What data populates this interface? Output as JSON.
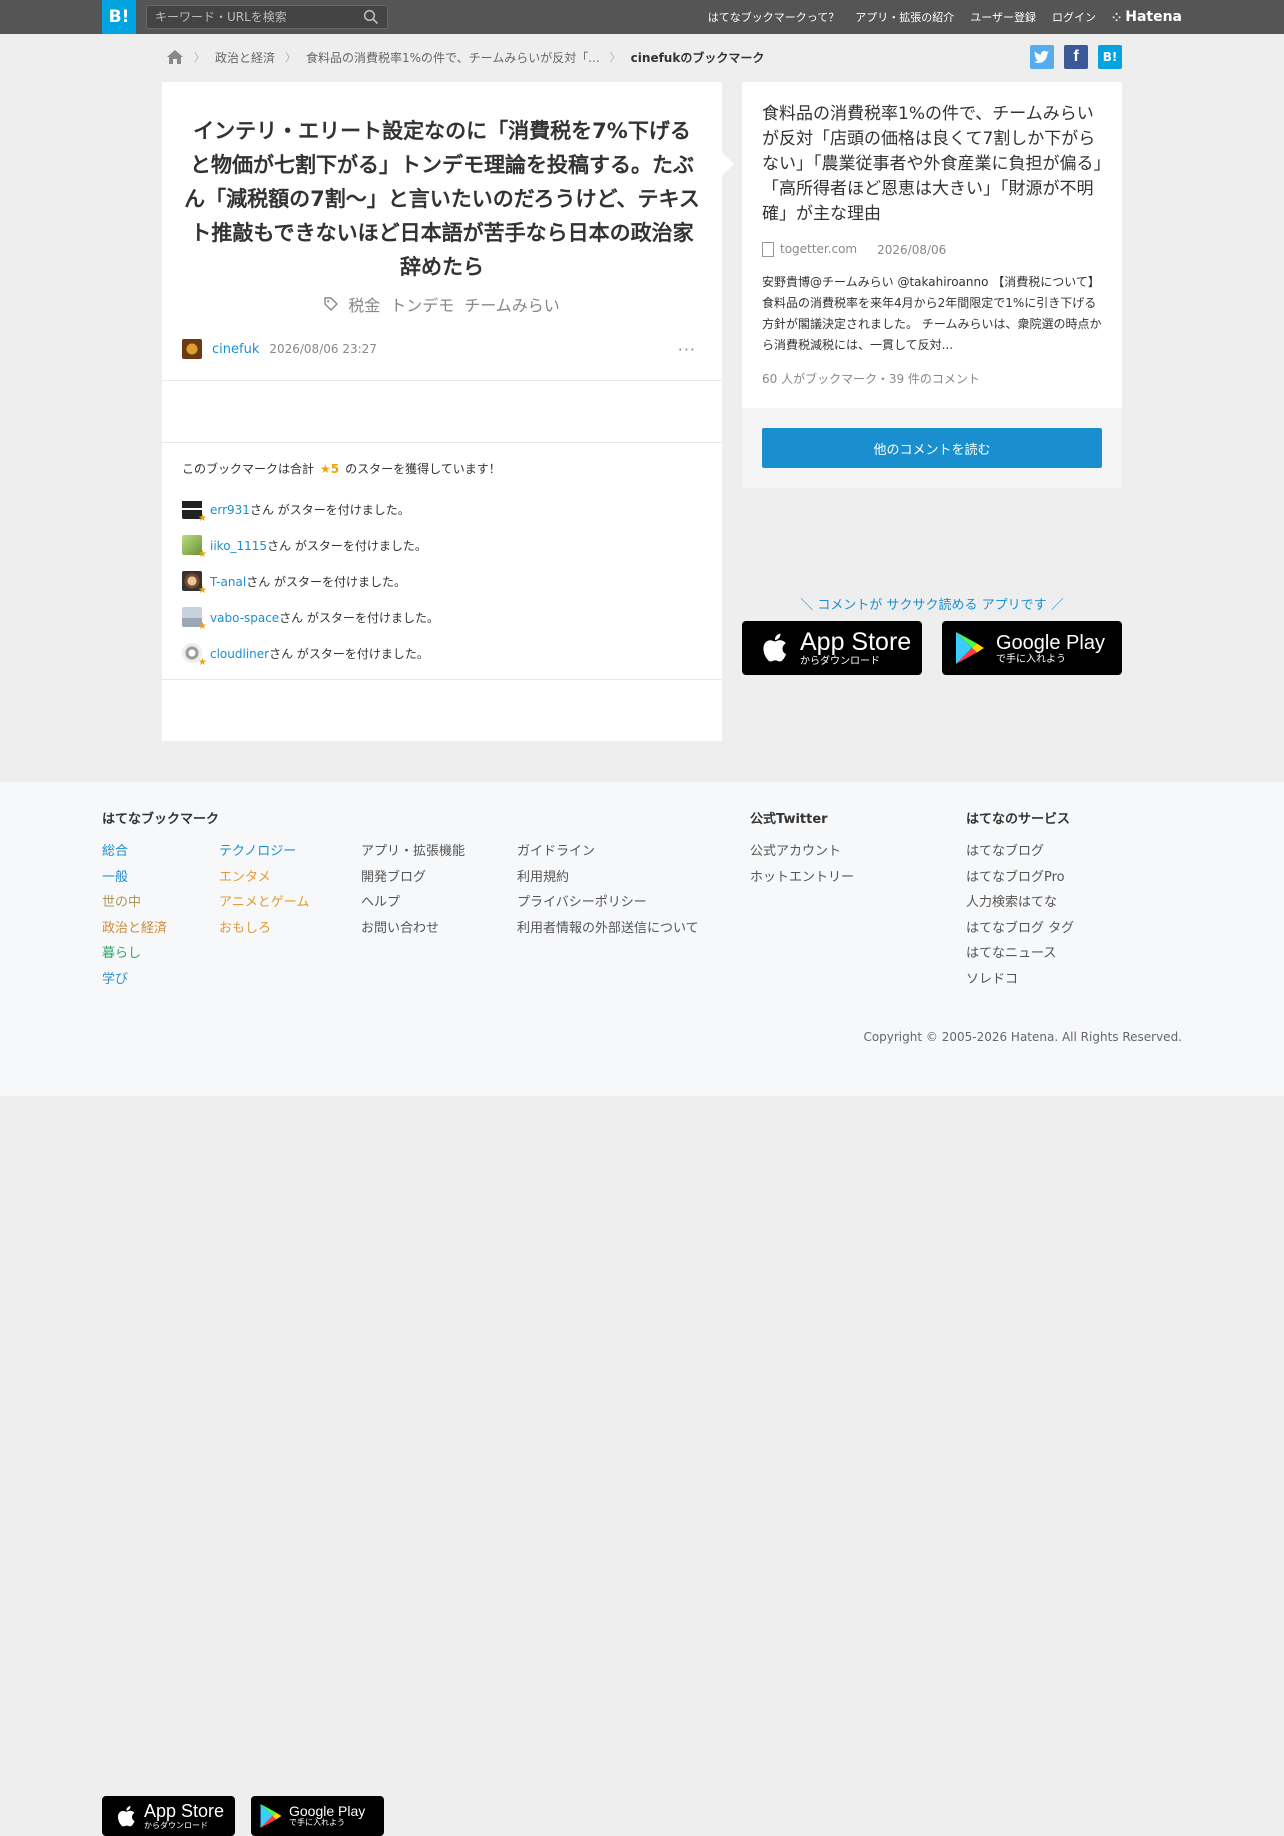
{
  "header": {
    "logo": "B!",
    "search_placeholder": "キーワード・URLを検索",
    "nav": [
      "はてなブックマークって？",
      "アプリ・拡張の紹介",
      "ユーザー登録",
      "ログイン"
    ],
    "hatena": "Hatena"
  },
  "breadcrumb": {
    "items": [
      "政治と経済",
      "食料品の消費税率1%の件で、チームみらいが反対「...",
      "cinefukのブックマーク"
    ]
  },
  "share": {
    "twitter": "t",
    "facebook": "f",
    "hatena": "B!"
  },
  "bookmark": {
    "comment": "インテリ・エリート設定なのに「消費税を7%下げると物価が七割下がる」トンデモ理論を投稿する。たぶん「減税額の7割〜」と言いたいのだろうけど、テキスト推敲もできないほど日本語が苦手なら日本の政治家辞めたら",
    "tags": [
      "税金",
      "トンデモ",
      "チームみらい"
    ],
    "author": "cinefuk",
    "date": "2026/08/06 23:27",
    "more": "···"
  },
  "stars": {
    "summary_prefix": "このブックマークは合計",
    "count": "★5",
    "summary_suffix": "のスターを獲得しています！",
    "suffix_text": "さん がスターを付けました。",
    "users": [
      "err931",
      "iiko_1115",
      "T-anal",
      "vabo-space",
      "cloudliner"
    ]
  },
  "entry": {
    "title": "食料品の消費税率1%の件で、チームみらいが反対「店頭の価格は良くて7割しか下がらない」「農業従事者や外食産業に負担が偏る」「高所得者ほど恩恵は大きい」「財源が不明確」が主な理由",
    "domain": "togetter.com",
    "date": "2026/08/06",
    "summary": "安野貴博@チームみらい @takahiroanno 【消費税について】 食料品の消費税率を来年4月から2年間限定で1%に引き下げる方針が閣議決定されました。 チームみらいは、衆院選の時点から消費税減税には、一貫して反対...",
    "stats": "60 人がブックマーク・39 件のコメント",
    "read_comments": "他のコメントを読む"
  },
  "app": {
    "tagline": "＼ コメントが サクサク読める アプリです ／",
    "appstore_main": "App Store",
    "appstore_sub": "からダウンロード",
    "googleplay_main": "Google Play",
    "googleplay_sub": "で手に入れよう"
  },
  "footer": {
    "section1": "はてなブックマーク",
    "col1": [
      "総合",
      "一般",
      "世の中",
      "政治と経済",
      "暮らし",
      "学び"
    ],
    "col2": [
      "テクノロジー",
      "エンタメ",
      "アニメとゲーム",
      "おもしろ"
    ],
    "col3": [
      "アプリ・拡張機能",
      "開発ブログ",
      "ヘルプ",
      "お問い合わせ"
    ],
    "col4": [
      "ガイドライン",
      "利用規約",
      "プライバシーポリシー",
      "利用者情報の外部送信について"
    ],
    "section2": "公式Twitter",
    "col5": [
      "公式アカウント",
      "ホットエントリー"
    ],
    "section3": "はてなのサービス",
    "col6": [
      "はてなブログ",
      "はてなブログPro",
      "人力検索はてな",
      "はてなブログ タグ",
      "はてなニュース",
      "ソレドコ"
    ],
    "copyright": "Copyright © 2005-2026 Hatena. All Rights Reserved."
  },
  "colors": {
    "accent": "#00a4de",
    "link": "#1a8fd0",
    "star": "#f2a300",
    "col1": [
      "#1a8fd0",
      "#1a8fd0",
      "#a59b5a",
      "#cf8a3a",
      "#33a36b",
      "#2f8fcf"
    ],
    "col2": [
      "#1a8fd0",
      "#e39a33",
      "#e39a33",
      "#e39a33"
    ]
  }
}
